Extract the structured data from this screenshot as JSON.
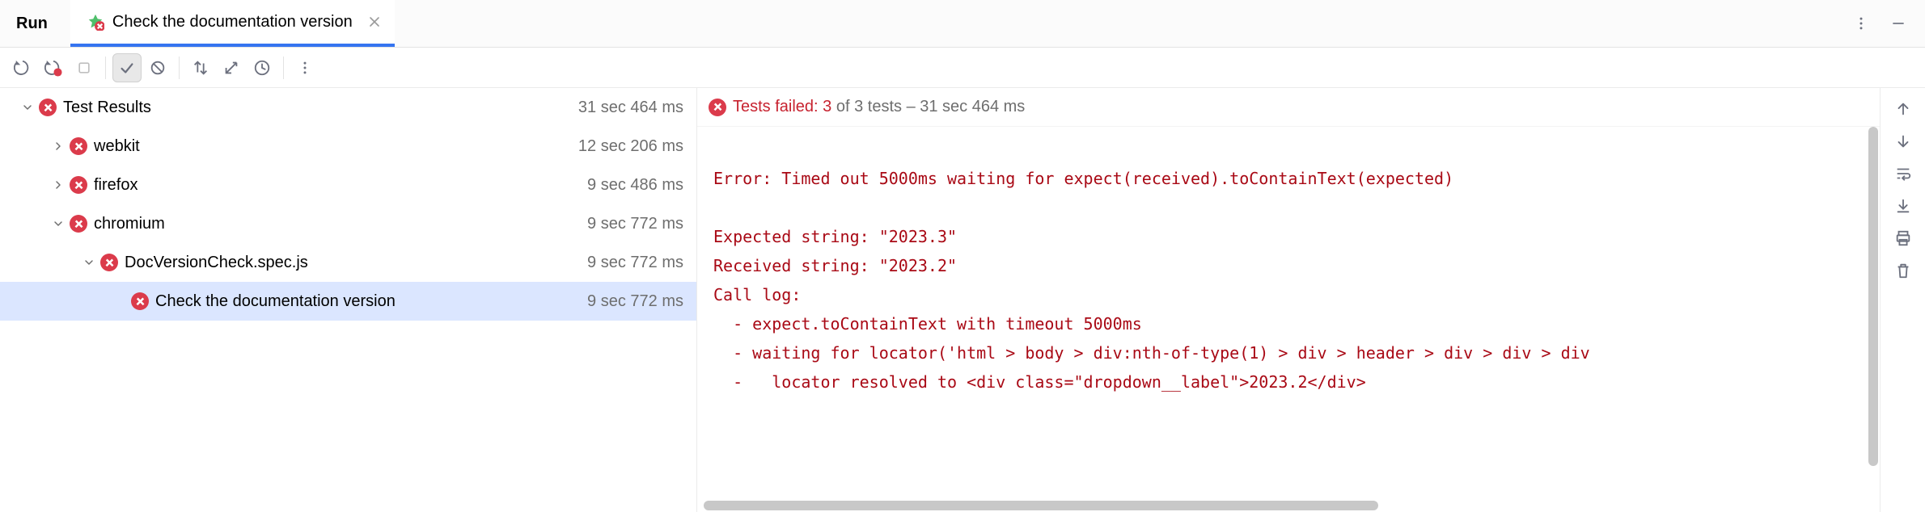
{
  "tabbar": {
    "tool_label": "Run",
    "tab_label": "Check the documentation version"
  },
  "tree": {
    "items": [
      {
        "label": "Test Results",
        "time": "31 sec 464 ms",
        "depth": 0,
        "chevron": "down",
        "selected": false
      },
      {
        "label": "webkit",
        "time": "12 sec 206 ms",
        "depth": 1,
        "chevron": "right",
        "selected": false
      },
      {
        "label": "firefox",
        "time": "9 sec 486 ms",
        "depth": 1,
        "chevron": "right",
        "selected": false
      },
      {
        "label": "chromium",
        "time": "9 sec 772 ms",
        "depth": 1,
        "chevron": "down",
        "selected": false
      },
      {
        "label": "DocVersionCheck.spec.js",
        "time": "9 sec 772 ms",
        "depth": 2,
        "chevron": "down",
        "selected": false
      },
      {
        "label": "Check the documentation version",
        "time": "9 sec 772 ms",
        "depth": 3,
        "chevron": "none",
        "selected": true
      }
    ]
  },
  "output_header": {
    "failed_prefix": "Tests failed: ",
    "failed_count": "3",
    "rest": " of 3 tests – 31 sec 464 ms"
  },
  "console_lines": [
    "",
    "Error: Timed out 5000ms waiting for expect(received).toContainText(expected)",
    "",
    "Expected string: \"2023.3\"",
    "Received string: \"2023.2\"",
    "Call log:",
    "  - expect.toContainText with timeout 5000ms",
    "  - waiting for locator('html > body > div:nth-of-type(1) > div > header > div > div > div",
    "  -   locator resolved to <div class=\"dropdown__label\">2023.2</div>"
  ]
}
